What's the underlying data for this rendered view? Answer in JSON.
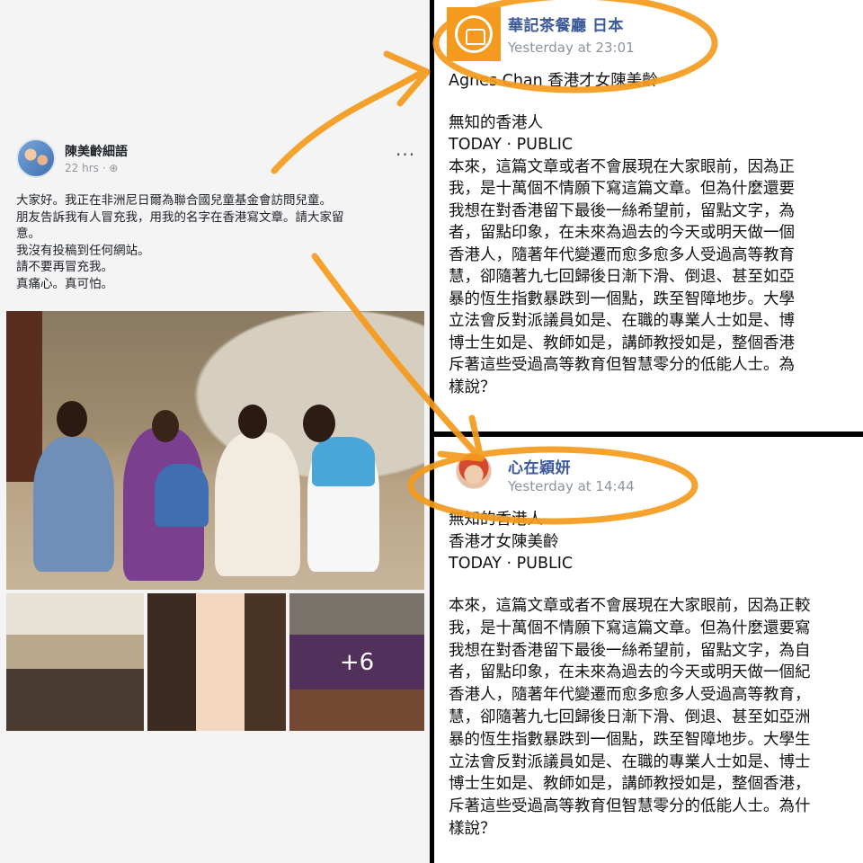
{
  "left_post": {
    "author": "陳美齡細語",
    "time": "22 hrs · ⊕",
    "more": "···",
    "lines": [
      "大家好。我正在非洲尼日爾為聯合國兒童基金會訪問兒童。",
      "朋友告訴我有人冒充我，用我的名字在香港寫文章。請大家留",
      "意。",
      "我沒有投稿到任何網站。",
      "請不要再冒充我。",
      "真痛心。真可怕。"
    ],
    "more_photos": "+6"
  },
  "top_post": {
    "page_name": "華記茶餐廳 日本",
    "time": "Yesterday at 23:01",
    "lines": [
      "Agnes Chan 香港才女陳美齡",
      "",
      "無知的香港人",
      "TODAY · PUBLIC",
      "本來，這篇文章或者不會展現在大家眼前，因為正",
      "我，是十萬個不情願下寫這篇文章。但為什麼還要",
      "我想在對香港留下最後一絲希望前，留點文字，為",
      "者，留點印象，在未來為過去的今天或明天做一個",
      "香港人，隨著年代變遷而愈多愈多人受過高等教育",
      "慧，卻隨著九七回歸後日漸下滑、倒退、甚至如亞",
      "暴的恆生指數暴跌到一個點，跌至智障地步。大學",
      "立法會反對派議員如是、在職的專業人士如是、博",
      "博士生如是、教師如是，講師教授如是，整個香港",
      "斥著這些受過高等教育但智慧零分的低能人士。為",
      "樣說？"
    ]
  },
  "bottom_post": {
    "page_name": "心在穎妍",
    "time": "Yesterday at 14:44",
    "header_lines": [
      "無知的香港人",
      "香港才女陳美齡",
      "TODAY · PUBLIC"
    ],
    "body_lines": [
      "本來，這篇文章或者不會展現在大家眼前，因為正較",
      "我，是十萬個不情願下寫這篇文章。但為什麼還要寫",
      "我想在對香港留下最後一絲希望前，留點文字，為自",
      "者，留點印象，在未來為過去的今天或明天做一個紀",
      "香港人，隨著年代變遷而愈多愈多人受過高等教育，",
      "慧，卻隨著九七回歸後日漸下滑、倒退、甚至如亞洲",
      "暴的恆生指數暴跌到一個點，跌至智障地步。大學生",
      "立法會反對派議員如是、在職的專業人士如是、博士",
      "博士生如是、教師如是，講師教授如是，整個香港，",
      "斥著這些受過高等教育但智慧零分的低能人士。為什",
      "樣說？"
    ]
  },
  "colors": {
    "annotation": "#f59a1c",
    "link_blue": "#3b5998",
    "muted": "#90949c"
  },
  "icons": [
    "more-icon",
    "globe-icon",
    "page-logo-icon"
  ]
}
